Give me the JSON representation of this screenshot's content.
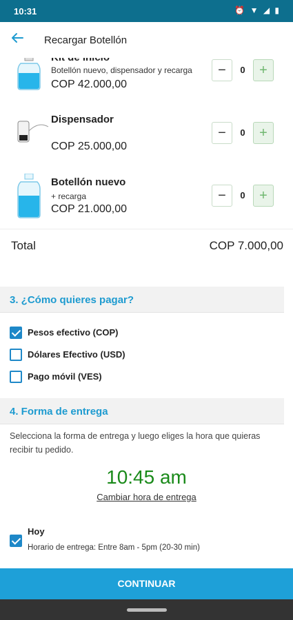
{
  "status_bar": {
    "time": "10:31",
    "icons_text": "⏰ ▼ ◢ ▮"
  },
  "header": {
    "title": "Recargar Botellón"
  },
  "products": [
    {
      "name": "Kit de inicio",
      "description": "Botellón nuevo, dispensador y recarga",
      "price": "COP  42.000,00",
      "quantity": "0"
    },
    {
      "name": "Dispensador",
      "description": "",
      "price": "COP  25.000,00",
      "quantity": "0"
    },
    {
      "name": "Botellón nuevo",
      "description": "+ recarga",
      "price": "COP  21.000,00",
      "quantity": "0"
    }
  ],
  "stepper": {
    "minus": "−",
    "plus": "+"
  },
  "total": {
    "label": "Total",
    "value": "COP 7.000,00"
  },
  "payment": {
    "title": "3. ¿Cómo quieres pagar?",
    "options": [
      {
        "label": "Pesos efectivo (COP)",
        "checked": true
      },
      {
        "label": "Dólares Efectivo (USD)",
        "checked": false
      },
      {
        "label": "Pago móvil (VES)",
        "checked": false
      }
    ]
  },
  "delivery": {
    "title": "4. Forma de entrega",
    "info": "Selecciona la forma de entrega y luego eliges la hora que quieras recibir tu pedido.",
    "time": "10:45 am",
    "change_time": "Cambiar hora de entrega",
    "today_label": "Hoy",
    "today_hours": "Horario de entrega: Entre 8am - 5pm (20-30 min)"
  },
  "continue_label": "CONTINUAR",
  "colors": {
    "status_bar": "#0d6f8e",
    "accent": "#1e9bd0",
    "time_green": "#1a8a1a",
    "button": "#1ea0d8"
  }
}
